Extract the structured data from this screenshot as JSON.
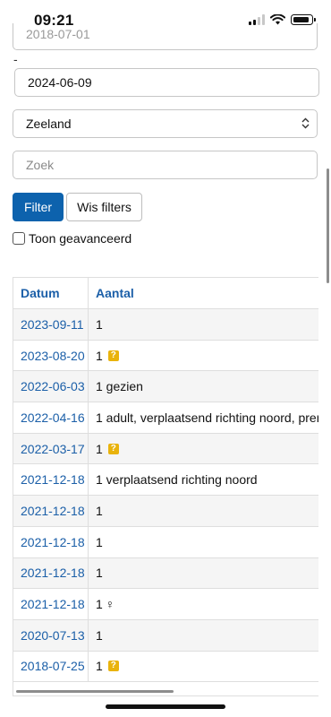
{
  "status_bar": {
    "time": "09:21"
  },
  "form": {
    "from_date_partial": "2018-07-01",
    "separator": "-",
    "to_date": "2024-06-09",
    "region_select": "Zeeland",
    "search_placeholder": "Zoek",
    "filter_button": "Filter",
    "clear_filters_button": "Wis filters",
    "advanced_checkbox_label": "Toon geavanceerd"
  },
  "table": {
    "columns": [
      "Datum",
      "Aantal"
    ],
    "rows": [
      {
        "date": "2023-09-11",
        "count": "1",
        "badge": ""
      },
      {
        "date": "2023-08-20",
        "count": "1",
        "badge": "?"
      },
      {
        "date": "2022-06-03",
        "count": "1 gezien",
        "badge": ""
      },
      {
        "date": "2022-04-16",
        "count": "1 adult, verplaatsend richting noord, pren",
        "badge": ""
      },
      {
        "date": "2022-03-17",
        "count": "1",
        "badge": "?"
      },
      {
        "date": "2021-12-18",
        "count": "1 verplaatsend richting noord",
        "badge": ""
      },
      {
        "date": "2021-12-18",
        "count": "1",
        "badge": ""
      },
      {
        "date": "2021-12-18",
        "count": "1",
        "badge": ""
      },
      {
        "date": "2021-12-18",
        "count": "1",
        "badge": ""
      },
      {
        "date": "2021-12-18",
        "count": "1",
        "badge": "♀"
      },
      {
        "date": "2020-07-13",
        "count": "1",
        "badge": ""
      },
      {
        "date": "2018-07-25",
        "count": "1",
        "badge": "?"
      }
    ]
  }
}
